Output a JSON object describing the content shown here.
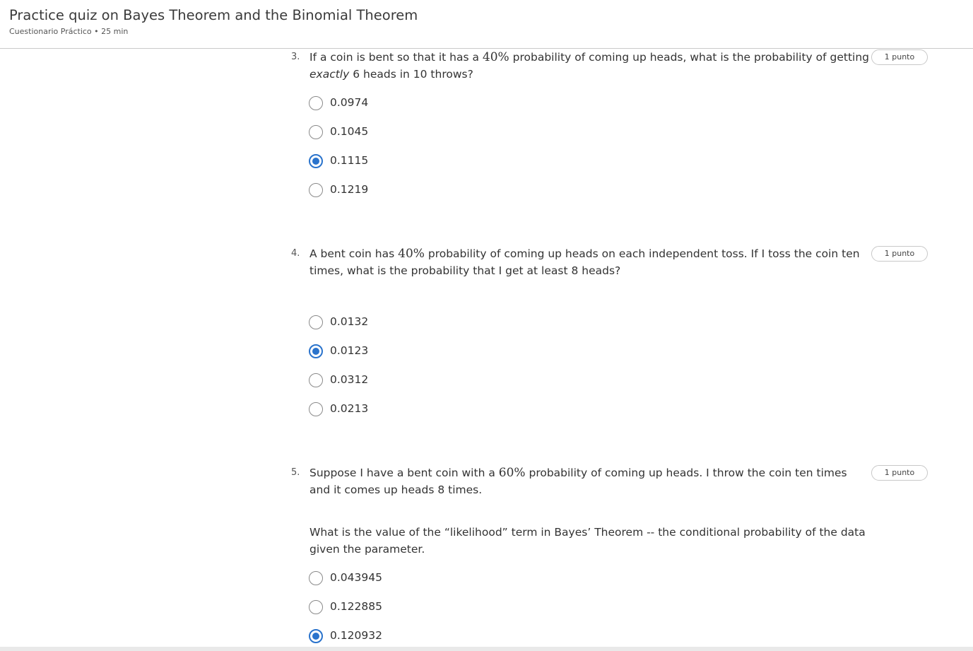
{
  "header": {
    "title": "Practice quiz on Bayes Theorem and the Binomial Theorem",
    "subtitle": "Cuestionario Práctico • 25 min"
  },
  "questions": [
    {
      "number": "3.",
      "text_before": "If a coin is bent so that it has a ",
      "math": "40%",
      "text_after": " probability of coming up heads, what is the probability of getting ",
      "emphasis": "exactly",
      "text_end": " 6 heads in 10 throws?",
      "points": "1 punto",
      "options": [
        "0.0974",
        "0.1045",
        "0.1115",
        "0.1219"
      ],
      "selected_index": 2
    },
    {
      "number": "4.",
      "text_before": "A bent coin has ",
      "math": "40%",
      "text_after": " probability of coming up heads on each independent toss. If I toss the coin ten times, what is the probability that I get at least 8 heads?",
      "points": "1 punto",
      "options": [
        "0.0132",
        "0.0123",
        "0.0312",
        "0.0213"
      ],
      "selected_index": 1
    },
    {
      "number": "5.",
      "text_before": "Suppose I have a bent coin with a ",
      "math": "60%",
      "text_after": " probability of coming up heads. I throw the coin ten times and it comes up heads 8 times.",
      "text_second": "What is the value of the “likelihood” term in Bayes’ Theorem -- the conditional probability of the data given the parameter.",
      "points": "1 punto",
      "options": [
        "0.043945",
        "0.122885",
        "0.120932"
      ],
      "selected_index": 2
    }
  ],
  "colors": {
    "accent": "#2a73cc",
    "divider": "#c9c9c9"
  }
}
